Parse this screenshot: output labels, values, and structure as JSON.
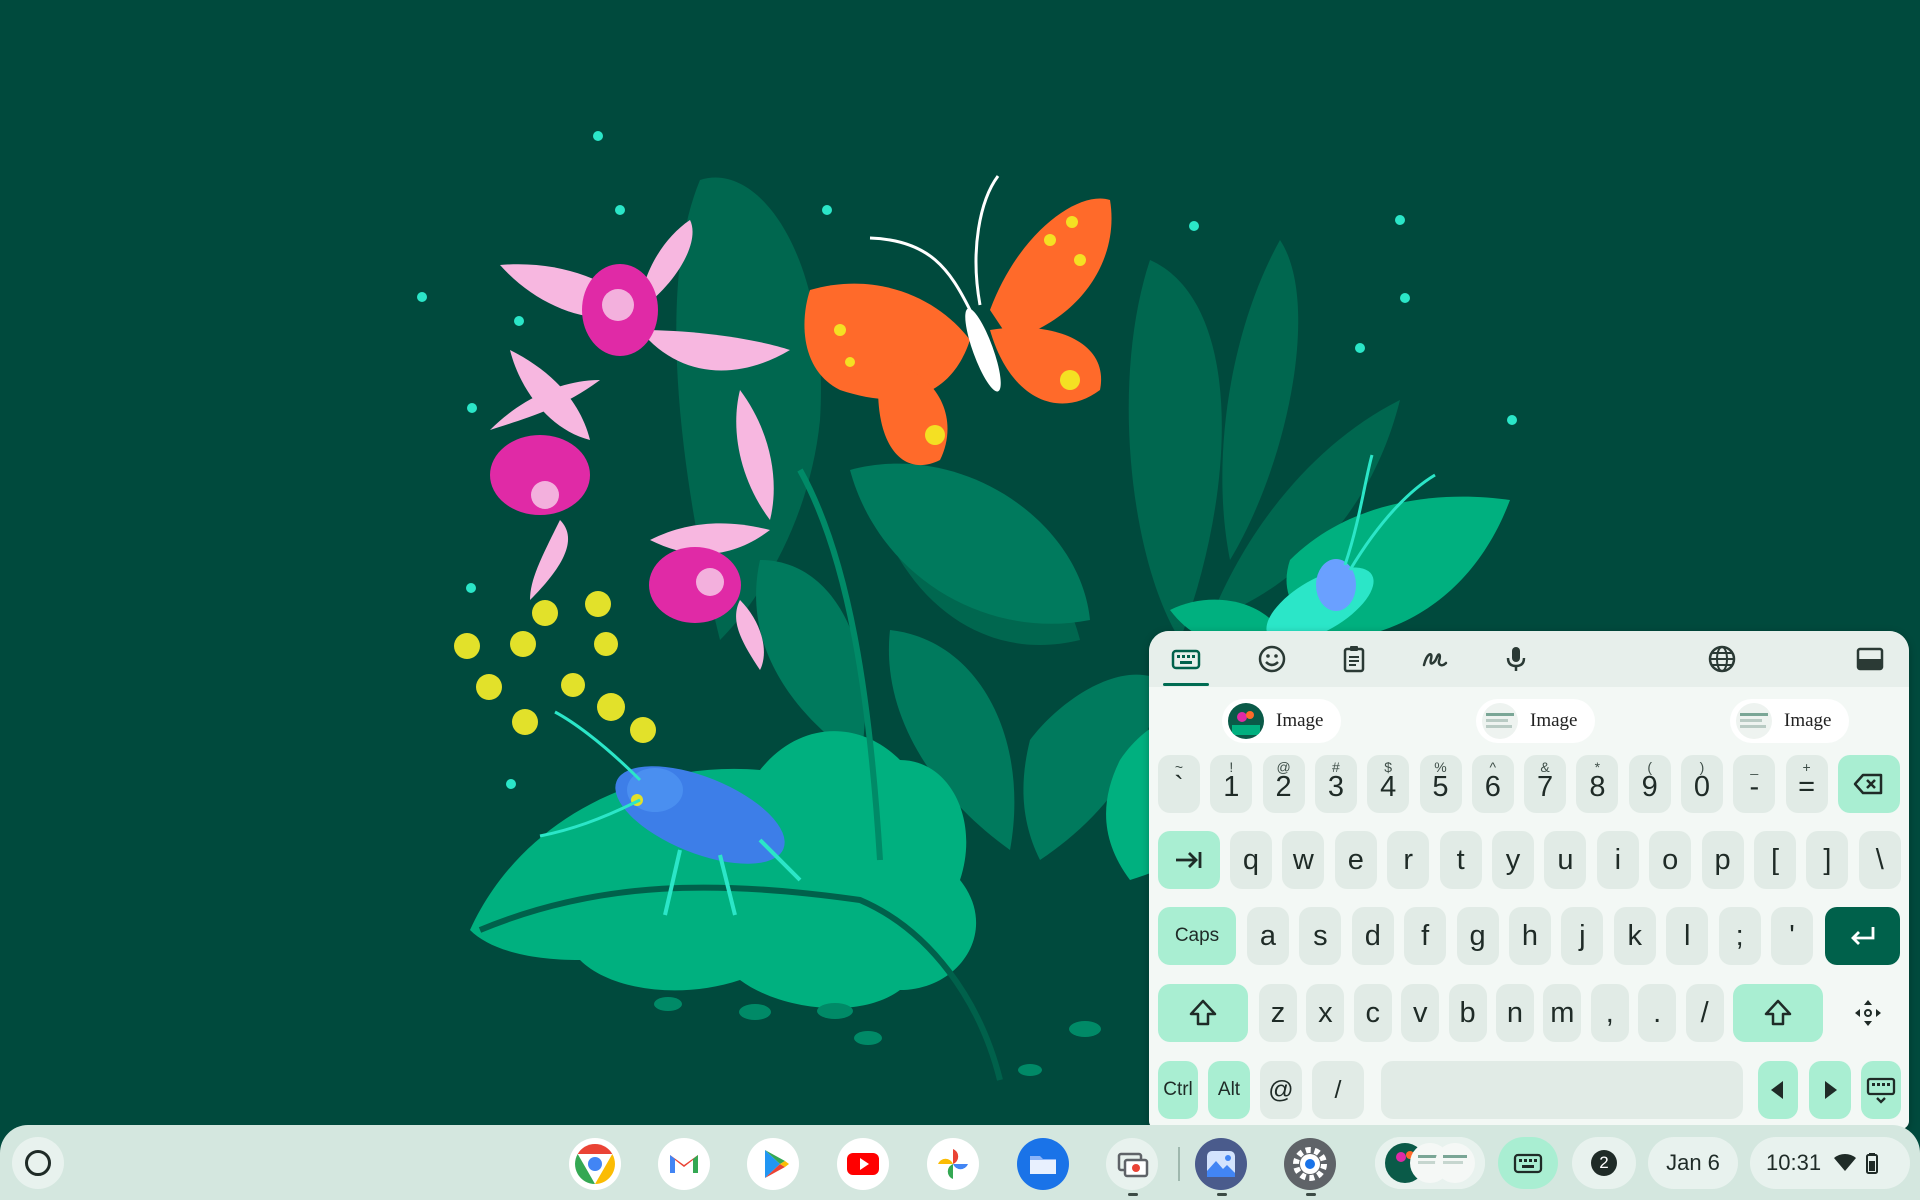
{
  "keyboard": {
    "toolbar": {
      "buttons": [
        "keyboard-icon",
        "emoji-icon",
        "clipboard-icon",
        "handwriting-icon",
        "microphone-icon",
        "globe-icon",
        "dock-icon"
      ]
    },
    "suggestions": [
      "Image",
      "Image",
      "Image"
    ],
    "rows": {
      "number": [
        {
          "main": "`",
          "sub": "~"
        },
        {
          "main": "1",
          "sub": "!"
        },
        {
          "main": "2",
          "sub": "@"
        },
        {
          "main": "3",
          "sub": "#"
        },
        {
          "main": "4",
          "sub": "$"
        },
        {
          "main": "5",
          "sub": "%"
        },
        {
          "main": "6",
          "sub": "^"
        },
        {
          "main": "7",
          "sub": "&"
        },
        {
          "main": "8",
          "sub": "*"
        },
        {
          "main": "9",
          "sub": "("
        },
        {
          "main": "0",
          "sub": ")"
        },
        {
          "main": "-",
          "sub": "_"
        },
        {
          "main": "=",
          "sub": "+"
        }
      ],
      "top": [
        "q",
        "w",
        "e",
        "r",
        "t",
        "y",
        "u",
        "i",
        "o",
        "p",
        "[",
        "]",
        "\\"
      ],
      "home": [
        "a",
        "s",
        "d",
        "f",
        "g",
        "h",
        "j",
        "k",
        "l",
        ";",
        "'"
      ],
      "bottom": [
        "z",
        "x",
        "c",
        "v",
        "b",
        "n",
        "m",
        ",",
        ".",
        "/"
      ]
    },
    "labels": {
      "caps": "Caps",
      "ctrl": "Ctrl",
      "alt": "Alt",
      "at": "@",
      "slash": "/"
    }
  },
  "shelf": {
    "apps": [
      "Chrome",
      "Gmail",
      "Play Store",
      "YouTube",
      "Photos",
      "Files",
      "Screen capture",
      "Gallery",
      "Settings"
    ],
    "tray": {
      "notification_count": "2",
      "date": "Jan 6",
      "time": "10:31"
    }
  }
}
